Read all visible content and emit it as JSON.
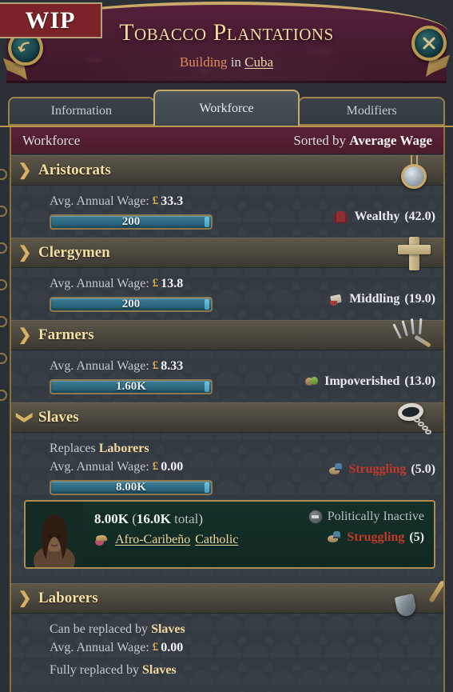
{
  "badge": {
    "label": "WIP"
  },
  "header": {
    "title": "Tobacco Plantations",
    "subtitle_prefix": "Building",
    "subtitle_mid": " in ",
    "location": "Cuba",
    "back_icon": "back-arrow-icon",
    "close_icon": "close-x-icon"
  },
  "tabs": [
    {
      "label": "Information",
      "active": false
    },
    {
      "label": "Workforce",
      "active": true
    },
    {
      "label": "Modifiers",
      "active": false
    }
  ],
  "workforce_bar": {
    "title": "Workforce",
    "sort_prefix": "Sorted by ",
    "sort_value": "Average Wage"
  },
  "labels": {
    "avg_wage": "Avg. Annual Wage:",
    "currency": "£",
    "replaces": "Replaces",
    "can_be_replaced": "Can be replaced by",
    "fully_replaced": "Fully replaced by",
    "total_suffix": "total",
    "politically_inactive": "Politically Inactive"
  },
  "colors": {
    "gold": "#f0d79c",
    "struggling_red": "#c0392b",
    "plate_maroon": "#4a1c33",
    "bar_blue": "#2f6c83",
    "badge_red": "#7b2329"
  },
  "sections": [
    {
      "name": "Aristocrats",
      "expanded": false,
      "chevron": "chevron-right-icon",
      "icon": "pocket-watch-icon",
      "wage": "33.3",
      "employees": "200",
      "wealth_label": "Wealthy",
      "wealth_value": "(42.0)",
      "wealth_icon": "armchair-icon",
      "wealth_style": "plain"
    },
    {
      "name": "Clergymen",
      "expanded": false,
      "chevron": "chevron-right-icon",
      "icon": "cross-icon",
      "wage": "13.8",
      "employees": "200",
      "wealth_label": "Middling",
      "wealth_value": "(19.0)",
      "wealth_icon": "middling-icon",
      "wealth_style": "plain"
    },
    {
      "name": "Farmers",
      "expanded": false,
      "chevron": "chevron-right-icon",
      "icon": "pitchfork-icon",
      "wage": "8.33",
      "employees": "1.60K",
      "wealth_label": "Impoverished",
      "wealth_value": "(13.0)",
      "wealth_icon": "impoverished-icon",
      "wealth_style": "plain"
    },
    {
      "name": "Slaves",
      "expanded": true,
      "chevron": "chevron-down-icon",
      "icon": "shackle-icon",
      "replaces_target": "Laborers",
      "wage": "0.00",
      "employees": "8.00K",
      "wealth_label": "Struggling",
      "wealth_value": "(5.0)",
      "wealth_icon": "struggling-icon",
      "wealth_style": "red",
      "pop": {
        "count": "8.00K",
        "total": "16.0K",
        "culture": "Afro-Caribeño",
        "religion": "Catholic",
        "culture_icon": "culture-icon",
        "political_label": "Politically Inactive",
        "political_icon": "politically-inactive-icon",
        "wealth_label": "Struggling",
        "wealth_value": "(5)",
        "wealth_icon": "struggling-icon",
        "portrait": "pop-portrait"
      }
    },
    {
      "name": "Laborers",
      "expanded": false,
      "chevron": "chevron-right-icon",
      "icon": "shovel-icon",
      "replaced_by": "Slaves",
      "wage": "0.00",
      "fully_replaced_by": "Slaves"
    }
  ]
}
